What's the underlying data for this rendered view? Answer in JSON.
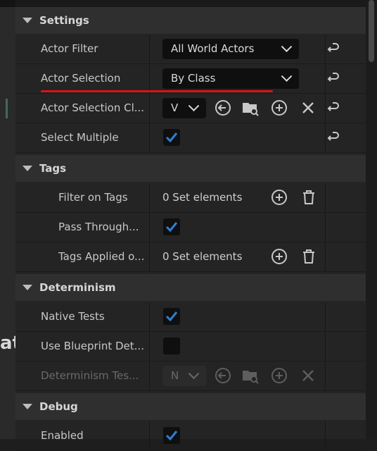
{
  "colors": {
    "accent_check": "#2f7fd0",
    "annotation_red": "#d6141a"
  },
  "left_strip": {
    "glyph": "at"
  },
  "sections": {
    "settings": "Settings",
    "tags": "Tags",
    "determinism": "Determinism",
    "debug": "Debug"
  },
  "settings": {
    "actor_filter": {
      "label": "Actor Filter",
      "value": "All World Actors"
    },
    "actor_selection": {
      "label": "Actor Selection",
      "value": "By Class"
    },
    "actor_selection_class": {
      "label": "Actor Selection Cl...",
      "value": "V"
    },
    "select_multiple": {
      "label": "Select Multiple",
      "checked": true
    }
  },
  "tags": {
    "filter_on_tags": {
      "label": "Filter on Tags",
      "value": "0 Set elements"
    },
    "pass_through": {
      "label": "Pass Through...",
      "checked": true
    },
    "tags_applied": {
      "label": "Tags Applied o...",
      "value": "0 Set elements"
    }
  },
  "determinism": {
    "native_tests": {
      "label": "Native Tests",
      "checked": true
    },
    "use_blueprint": {
      "label": "Use Blueprint Det...",
      "checked": false
    },
    "determinism_tests": {
      "label": "Determinism Tes...",
      "value": "N"
    }
  },
  "debug": {
    "enabled": {
      "label": "Enabled",
      "checked": true
    }
  },
  "icons": [
    "reset-arrow-icon",
    "chevron-down-icon",
    "use-selected-icon",
    "browse-folder-icon",
    "add-icon",
    "clear-icon",
    "delete-icon",
    "checkmark-icon"
  ]
}
